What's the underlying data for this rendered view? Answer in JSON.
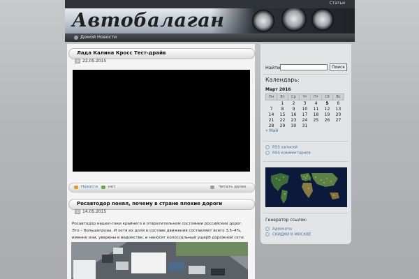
{
  "header": {
    "top_link": "Статьи",
    "site_title": "Автобалаган",
    "nav": [
      {
        "label": "Домой"
      },
      {
        "label": "Новости"
      }
    ]
  },
  "posts": [
    {
      "title": "Лада Калина Кросс Тест-драйв",
      "date": "22.05.2015",
      "category": "Новости",
      "tags": "нет",
      "read_more": "Читать далее"
    },
    {
      "title": "Росавтодор понял, почему в стране плохие дороги",
      "date": "14.05.2015",
      "excerpt": "Росавтодор нашел-таки крайнего в отвратительном состоянии российских дорог. Это – большегрузы. И хотя их доля в составе движения составляет всего 3,5–4%, именно они, уверены в ведомстве, и наносят колоссальный ущерб дорожной сети."
    }
  ],
  "sidebar": {
    "search": {
      "label": "Найти:",
      "value": "",
      "button": "Поиск"
    },
    "calendar": {
      "title": "Календарь:",
      "month": "Март 2016",
      "weekdays": [
        "Пн",
        "Вт",
        "Ср",
        "Чт",
        "Пт",
        "Сб",
        "Вс"
      ],
      "weeks": [
        [
          "",
          "1",
          "2",
          "3",
          "4",
          "5",
          "6"
        ],
        [
          "7",
          "8",
          "9",
          "10",
          "11",
          "12",
          "13"
        ],
        [
          "14",
          "15",
          "16",
          "17",
          "18",
          "19",
          "20"
        ],
        [
          "21",
          "22",
          "23",
          "24",
          "25",
          "26",
          "27"
        ],
        [
          "28",
          "29",
          "30",
          "31",
          "",
          "",
          ""
        ]
      ],
      "today": "5",
      "prev_link": "« Май"
    },
    "rss": [
      {
        "label": "RSS записей"
      },
      {
        "label": "RSS комментариев"
      }
    ],
    "links": {
      "title": "Генератор ссылок:",
      "items": [
        {
          "label": "Адвокаты"
        },
        {
          "label": "СКИДКИ В МОСКВЕ"
        }
      ]
    }
  },
  "colors": {
    "link": "#3a6ea5",
    "header_dark": "#303337"
  }
}
